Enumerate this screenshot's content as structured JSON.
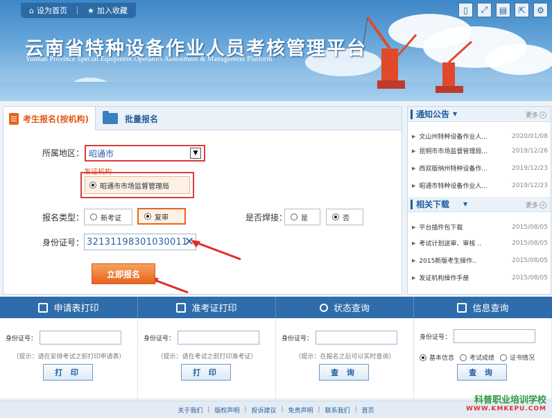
{
  "header": {
    "set_home": "设为首页",
    "bookmark": "加入收藏",
    "title": "云南省特种设备作业人员考核管理平台",
    "subtitle": "Yunnan Province Special Equipment Operators Assessment & Management Platform",
    "toolbar_icons": [
      "phone-icon",
      "fullscreen-icon",
      "edit-icon",
      "export-icon",
      "settings-icon"
    ]
  },
  "registration": {
    "tabs": [
      {
        "label": "考生报名(按机构)",
        "active": true,
        "icon": "document-icon"
      },
      {
        "label": "批量报名",
        "active": false,
        "icon": "folder-icon"
      }
    ],
    "region_label": "所属地区：",
    "region_value": "昭通市",
    "issuer_label": "发证机构",
    "issuer_option": "昭通市市场监督管理局",
    "type_label": "报名类型：",
    "type_options": [
      {
        "label": "新考证",
        "selected": false
      },
      {
        "label": "复审",
        "selected": true
      }
    ],
    "weld_label": "是否焊接：",
    "weld_options": [
      {
        "label": "是",
        "selected": false
      },
      {
        "label": "否",
        "selected": true
      }
    ],
    "id_label": "身份证号：",
    "id_value": "32131198301030011",
    "submit_label": "立即报名"
  },
  "notices": {
    "title": "通知公告",
    "more": "更多",
    "items": [
      {
        "title": "文山州特种设备作业人...",
        "date": "2020/01/08"
      },
      {
        "title": "昆明市市场监督管理局...",
        "date": "2019/12/26"
      },
      {
        "title": "西双版纳州特种设备作...",
        "date": "2019/12/23"
      },
      {
        "title": "昭通市特种设备作业人...",
        "date": "2019/12/23"
      }
    ]
  },
  "downloads": {
    "title": "相关下载",
    "more": "更多",
    "items": [
      {
        "title": "平台插件包下载",
        "date": "2015/08/05"
      },
      {
        "title": "考试计划送审、审核 ..",
        "date": "2015/08/05"
      },
      {
        "title": "2015新版考生操作..",
        "date": "2015/08/05"
      },
      {
        "title": "发证机构操作手册",
        "date": "2015/08/05"
      }
    ]
  },
  "services": [
    {
      "label": "申请表打印",
      "icon": "printer-icon",
      "id_label": "身份证号：",
      "hint": "（提示：请在安排考试之前打印申请表）",
      "button": "打 印"
    },
    {
      "label": "准考证打印",
      "icon": "ticket-icon",
      "id_label": "身份证号：",
      "hint": "（提示：请在考试之前打印准考证）",
      "button": "打 印"
    },
    {
      "label": "状态查询",
      "icon": "search-icon",
      "id_label": "身份证号：",
      "hint": "（提示：在报名之后可以实时查询）",
      "button": "查 询"
    },
    {
      "label": "信息查询",
      "icon": "info-icon",
      "id_label": "身份证号：",
      "options": [
        {
          "label": "基本信息",
          "selected": true
        },
        {
          "label": "考试成绩",
          "selected": false
        },
        {
          "label": "证书情况",
          "selected": false
        }
      ],
      "button": "查 询"
    }
  ],
  "footer": {
    "links": [
      "关于我们",
      "版权声明",
      "投诉建议",
      "免责声明",
      "联系我们",
      "首页"
    ]
  },
  "watermark": {
    "line1": "科普职业培训学校",
    "line2": "WWW.KMKEPU.COM"
  },
  "colors": {
    "primary_blue": "#2f6cab",
    "accent_orange": "#e8641f",
    "highlight_red": "#d93b3b"
  }
}
